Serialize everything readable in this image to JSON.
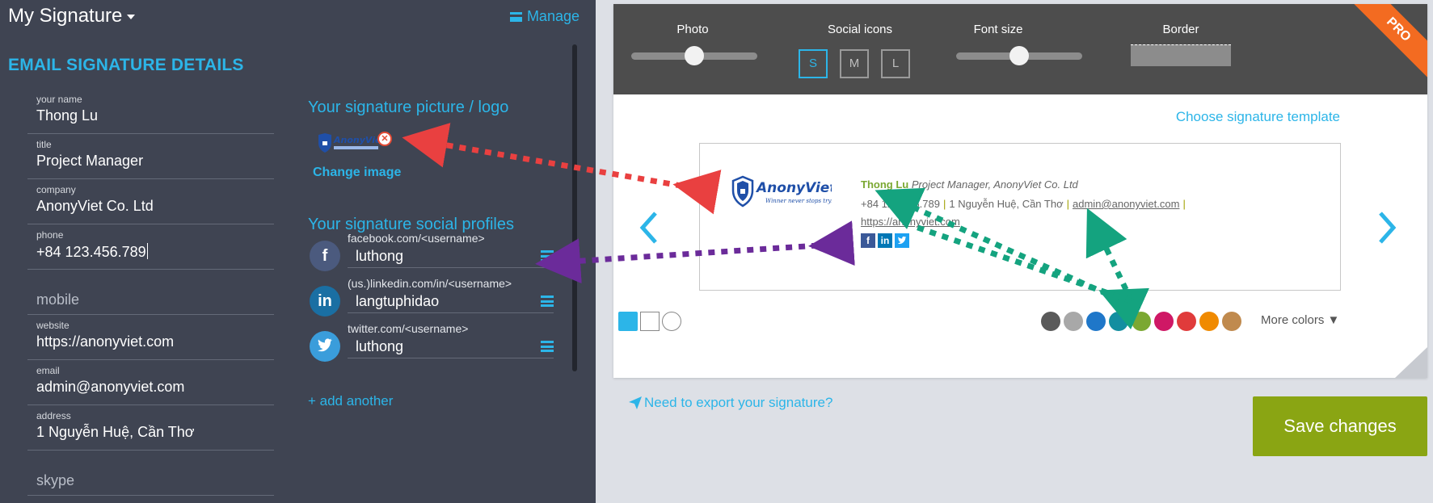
{
  "header": {
    "title": "My Signature",
    "manage_label": "Manage"
  },
  "details": {
    "section_title": "EMAIL SIGNATURE DETAILS",
    "fields": [
      {
        "label": "your name",
        "value": "Thong Lu"
      },
      {
        "label": "title",
        "value": "Project Manager"
      },
      {
        "label": "company",
        "value": "AnonyViet Co. Ltd"
      },
      {
        "label": "phone",
        "value": "+84 123.456.789"
      },
      {
        "placeholder": "mobile"
      },
      {
        "label": "website",
        "value": "https://anonyviet.com"
      },
      {
        "label": "email",
        "value": "admin@anonyviet.com"
      },
      {
        "label": "address",
        "value": "1 Nguyễn Huệ, Cần Thơ"
      },
      {
        "placeholder": "skype"
      }
    ]
  },
  "picture": {
    "title": "Your signature picture / logo",
    "logo_text": "AnonyViet",
    "change_label": "Change image"
  },
  "social": {
    "title": "Your signature social profiles",
    "profiles": [
      {
        "network": "facebook",
        "icon": "f",
        "hint": "facebook.com/<username>",
        "value": "luthong",
        "color": "#3b5998"
      },
      {
        "network": "linkedin",
        "icon": "in",
        "hint": "(us.)linkedin.com/in/<username>",
        "value": "langtuphidao",
        "color": "#0077b5"
      },
      {
        "network": "twitter",
        "icon": "twitter-bird",
        "hint": "twitter.com/<username>",
        "value": "luthong",
        "color": "#1da1f2"
      }
    ],
    "add_label": "+ add another"
  },
  "toolbar": {
    "photo_label": "Photo",
    "social_icons_label": "Social icons",
    "font_size_label": "Font size",
    "border_label": "Border",
    "size_options": [
      "S",
      "M",
      "L"
    ],
    "size_selected": "S",
    "photo_slider_level": 0.5,
    "font_size_slider_level": 0.5,
    "pro_badge": "PRO"
  },
  "preview": {
    "choose_template": "Choose signature template",
    "logo_text": "AnonyViet",
    "logo_tagline": "Winner never stops trying",
    "name": "Thong Lu",
    "title_company": "Project Manager, AnonyViet Co. Ltd",
    "phone": "+84 123.456.789",
    "address": "1 Nguyễn Huệ, Cần Thơ",
    "email": "admin@anonyviet.com",
    "website": "https://anonyviet.com",
    "social_icons": [
      "f",
      "in",
      "twitter-bird"
    ]
  },
  "colors": {
    "layout_swatches": [
      "#2cb5e8",
      "square-outline",
      "circle-outline"
    ],
    "swatches": [
      "#5a5a5a",
      "#a8a8a8",
      "#1f77c9",
      "#138ea0",
      "#7ba832",
      "#cf1865",
      "#e03b3b",
      "#f08a00",
      "#c08a4e"
    ],
    "more_label": "More colors",
    "accent": "#2cb5e8",
    "save_color": "#8aa513"
  },
  "footer": {
    "export_label": "Need to export your signature?",
    "save_label": "Save changes"
  }
}
